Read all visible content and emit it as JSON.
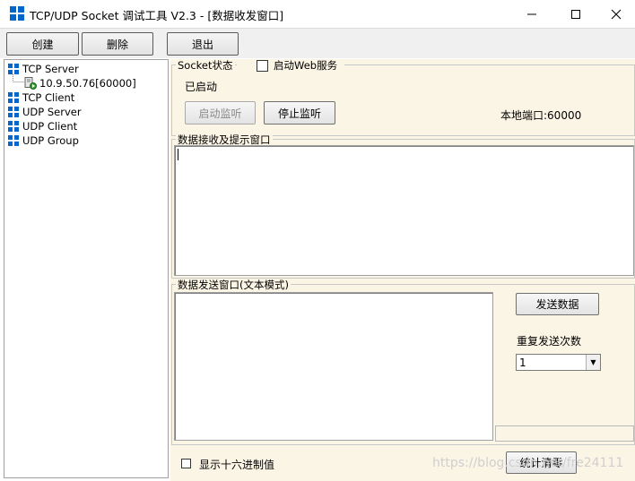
{
  "window": {
    "title": "TCP/UDP Socket 调试工具 V2.3 - [数据收发窗口]",
    "minimize_glyph": "—",
    "maximize_glyph": "☐",
    "close_glyph": "✕"
  },
  "toolbar": {
    "create_label": "创建",
    "delete_label": "删除",
    "exit_label": "退出"
  },
  "tree": {
    "items": [
      {
        "label": "TCP Server",
        "icon": "blue-grid-icon"
      },
      {
        "label": "10.9.50.76[60000]",
        "icon": "connection-icon"
      },
      {
        "label": "TCP Client",
        "icon": "blue-grid-icon"
      },
      {
        "label": "UDP Server",
        "icon": "blue-grid-icon"
      },
      {
        "label": "UDP Client",
        "icon": "blue-grid-icon"
      },
      {
        "label": "UDP Group",
        "icon": "blue-grid-icon"
      }
    ]
  },
  "socket_status": {
    "group_title": "Socket状态",
    "web_service_label": "启动Web服务",
    "web_service_checked": false,
    "status_text": "已启动",
    "start_listen_label": "启动监听",
    "start_listen_enabled": false,
    "stop_listen_label": "停止监听",
    "local_port_text": "本地端口:60000"
  },
  "receive": {
    "group_title": "数据接收及提示窗口",
    "content": ""
  },
  "send": {
    "group_title": "数据发送窗口(文本模式)",
    "content": "",
    "send_button_label": "发送数据",
    "repeat_label": "重复发送次数",
    "repeat_value": "1",
    "dropdown_glyph": "▼"
  },
  "bottom": {
    "hex_label": "显示十六进制值",
    "hex_checked": false,
    "stats_clear_label": "统计清零"
  },
  "watermark": "https://blog.csdn.net/fre24111",
  "colors": {
    "accent_blue": "#0066cc",
    "panel_bg": "#fbf5e6",
    "toolbar_bg": "#f0f0f0"
  }
}
